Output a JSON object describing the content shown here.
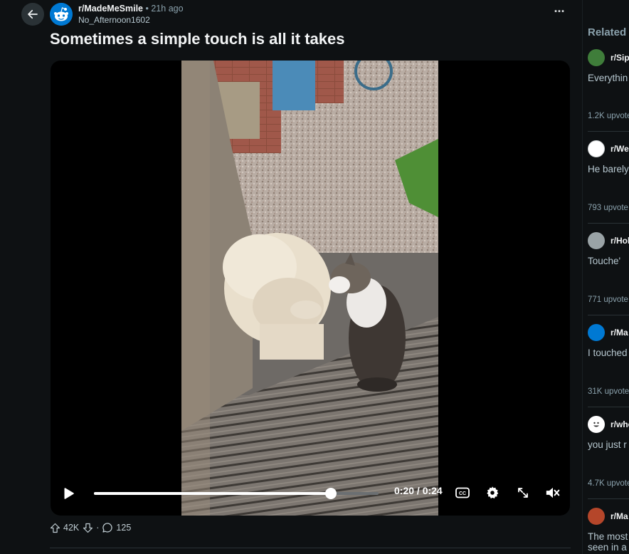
{
  "post": {
    "subreddit": "r/MadeMeSmile",
    "time": "21h ago",
    "author": "No_Afternoon1602",
    "title": "Sometimes a simple touch is all it takes"
  },
  "player": {
    "time_display": "0:20 / 0:24",
    "progress": 0.833
  },
  "actions": {
    "upvotes": "42K",
    "comments": "125"
  },
  "related": {
    "heading": "Related",
    "items": [
      {
        "subreddit": "r/Sip",
        "text": "Everythin",
        "votes": "1.2K upvote",
        "icon_color": "#3f7d3a"
      },
      {
        "subreddit": "r/We",
        "text": "He barely",
        "votes": "793 upvote",
        "icon_color": "#ffffff"
      },
      {
        "subreddit": "r/Hol",
        "text": "Touche'",
        "votes": "771 upvote",
        "icon_color": "#9aa3a6"
      },
      {
        "subreddit": "r/Ma",
        "text": "I touched",
        "votes": "31K upvote",
        "icon_color": "#0079d3"
      },
      {
        "subreddit": "r/whe",
        "text": "you just r",
        "votes": "4.7K upvote",
        "icon_color": "#ffffff"
      },
      {
        "subreddit": "r/Ma",
        "text": "The most",
        "text2": "seen in a",
        "votes": "",
        "icon_color": "#b5462a"
      }
    ]
  }
}
